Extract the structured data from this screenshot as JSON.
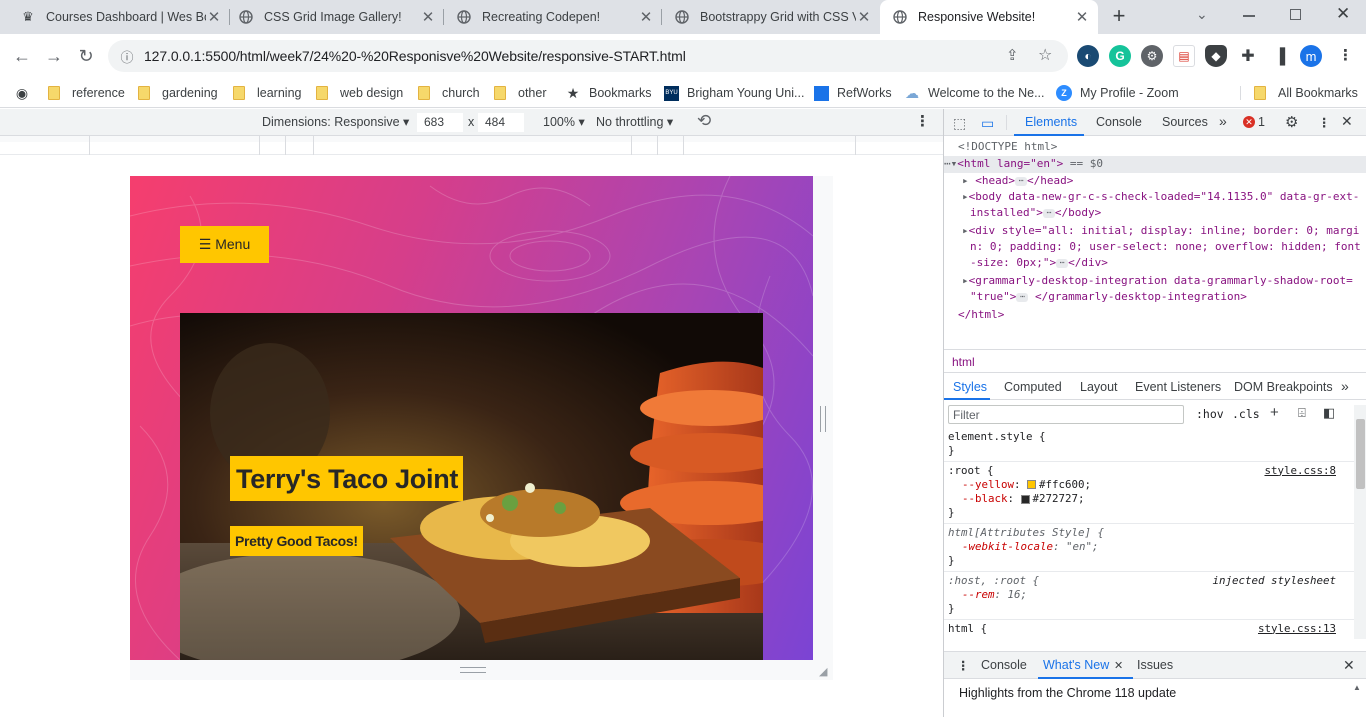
{
  "tabs": [
    {
      "title": "Courses Dashboard | Wes Bo",
      "icon": "crown-icon"
    },
    {
      "title": "CSS Grid Image Gallery!",
      "icon": "globe-icon"
    },
    {
      "title": "Recreating Codepen!",
      "icon": "globe-icon"
    },
    {
      "title": "Bootstrappy Grid with CSS V",
      "icon": "globe-icon"
    },
    {
      "title": "Responsive Website!",
      "icon": "globe-icon",
      "active": true
    }
  ],
  "toolbar": {
    "url": "127.0.0.1:5500/html/week7/24%20-%20Responisve%20Website/responsive-START.html",
    "profile_initial": "m"
  },
  "bookmarks": [
    {
      "label": "reference",
      "type": "folder"
    },
    {
      "label": "gardening",
      "type": "folder"
    },
    {
      "label": "learning",
      "type": "folder"
    },
    {
      "label": "web design",
      "type": "folder"
    },
    {
      "label": "church",
      "type": "folder"
    },
    {
      "label": "other",
      "type": "folder"
    },
    {
      "label": "Bookmarks",
      "type": "star"
    },
    {
      "label": "Brigham Young Uni...",
      "type": "byu"
    },
    {
      "label": "RefWorks",
      "type": "refworks"
    },
    {
      "label": "Welcome to the Ne...",
      "type": "cloud"
    },
    {
      "label": "My Profile - Zoom",
      "type": "zoom"
    },
    {
      "label": "All Bookmarks",
      "type": "folder"
    }
  ],
  "device_toolbar": {
    "dimensions_label": "Dimensions: Responsive",
    "width": "683",
    "times": "x",
    "height": "484",
    "zoom": "100%",
    "throttle": "No throttling"
  },
  "site": {
    "menu_label": "☰ Menu",
    "title": "Terry's Taco Joint",
    "subtitle": "Pretty Good Tacos!"
  },
  "devtools": {
    "tabs": [
      "Elements",
      "Console",
      "Sources"
    ],
    "error_count": "1",
    "dom_lines": {
      "doctype": "<!DOCTYPE html>",
      "html_open": "<html lang=\"en\">",
      "html_eq": " == $0",
      "head": "<head>",
      "head_close": "</head>",
      "body_attr": "<body data-new-gr-c-s-check-loaded=\"14.1135.0\" data-gr-ext-",
      "body_attr2": "installed\">",
      "body_close": "</body>",
      "div_style1": "<div style=\"all: initial; display: inline; border: 0; margi",
      "div_style2": "n: 0; padding: 0; user-select: none; overflow: hidden; font",
      "div_style3": "-size: 0px;\">",
      "div_close": "</div>",
      "gram1": "<grammarly-desktop-integration data-grammarly-shadow-root=",
      "gram2": "\"true\">",
      "gram_close": "</grammarly-desktop-integration>",
      "html_close": "</html>"
    },
    "breadcrumb": "html",
    "style_tabs": [
      "Styles",
      "Computed",
      "Layout",
      "Event Listeners",
      "DOM Breakpoints"
    ],
    "filter_placeholder": "Filter",
    "hov": ":hov",
    "cls": ".cls",
    "rules": {
      "element_style": "element.style {",
      "close": "}",
      "root_sel": ":root {",
      "root_src": "style.css:8",
      "yellow_prop": "--yellow",
      "yellow_val": "#ffc600;",
      "black_prop": "--black",
      "black_val": "#272727;",
      "attr_sel": "html[Attributes Style] {",
      "locale_prop": "-webkit-locale",
      "locale_val": "\"en\";",
      "host_sel": ":host, :root {",
      "host_src": "injected stylesheet",
      "rem_prop": "--rem",
      "rem_val": "16;",
      "html_sel": "html {",
      "html_src": "style.css:13"
    },
    "drawer_tabs": [
      "Console",
      "What's New",
      "Issues"
    ],
    "whats_new": "Highlights from the Chrome 118 update"
  },
  "colors": {
    "yellow": "#ffc600",
    "black": "#272727",
    "accent": "#1a73e8"
  }
}
